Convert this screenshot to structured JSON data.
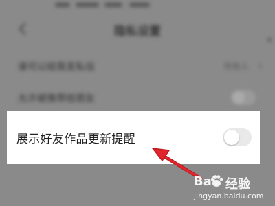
{
  "colors": {
    "overlay": "#8a8a8a",
    "card": "#ffffff",
    "toggle_off": "#e9e9e9",
    "annotation_arrow": "#e0262c",
    "watermark": "#f4f4f4"
  },
  "header": {
    "title": "隐私设置"
  },
  "background_rows": [
    {
      "label": "谁可以给我发私信",
      "value": "所有人",
      "control": "chevron"
    },
    {
      "label": "允许被推荐给朋友",
      "control": "toggle"
    }
  ],
  "highlighted_setting": {
    "label": "展示好友作品更新提醒",
    "toggle_state": "off"
  },
  "watermark": {
    "brand_prefix": "Bai",
    "brand_suffix": "经验",
    "url": "jingyan.baidu.com"
  }
}
